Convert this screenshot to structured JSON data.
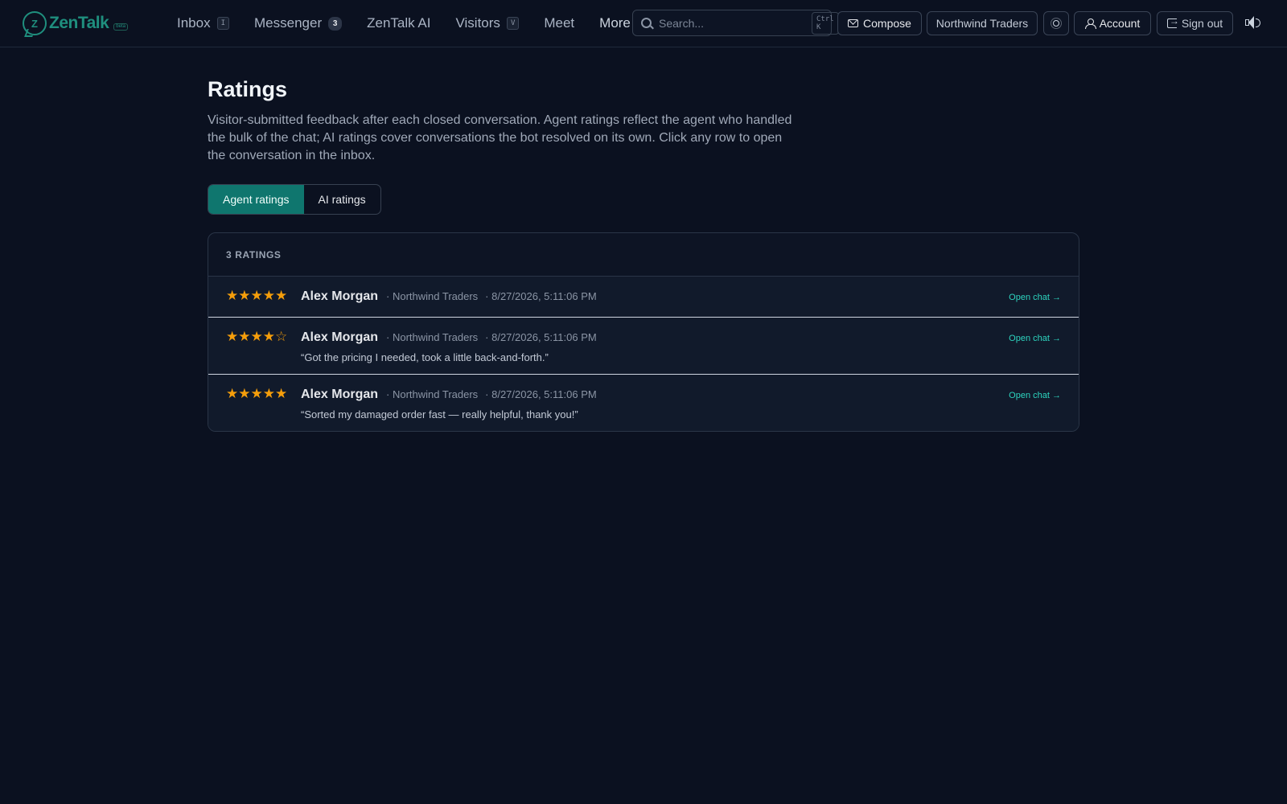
{
  "brand": {
    "name": "ZenTalk",
    "tag": "beta",
    "mark": "Z",
    "accent": "#1f8f7e"
  },
  "nav": {
    "inbox": {
      "label": "Inbox",
      "shortcut": "I"
    },
    "messenger": {
      "label": "Messenger",
      "count": "3"
    },
    "ai": {
      "label": "ZenTalk AI"
    },
    "visitors": {
      "label": "Visitors",
      "shortcut": "V"
    },
    "meet": {
      "label": "Meet"
    },
    "more": {
      "label": "More"
    }
  },
  "search": {
    "placeholder": "Search...",
    "shortcut": "Ctrl K"
  },
  "header_actions": {
    "compose": "Compose",
    "workspace": "Northwind Traders",
    "account": "Account",
    "sign_out": "Sign out",
    "icons": [
      "sun-icon",
      "speaker-icon"
    ]
  },
  "page": {
    "title": "Ratings",
    "description": "Visitor-submitted feedback after each closed conversation. Agent ratings reflect the agent who handled the bulk of the chat; AI ratings cover conversations the bot resolved on its own. Click any row to open the conversation in the inbox."
  },
  "tabs": [
    {
      "label": "Agent ratings",
      "active": true
    },
    {
      "label": "AI ratings",
      "active": false
    }
  ],
  "ratings": {
    "count_label": "3 RATINGS",
    "open_label": "Open chat →",
    "rows": [
      {
        "stars": "★★★★★",
        "rating": 5,
        "agent": "Alex Morgan",
        "company": "· Northwind Traders",
        "date": "· 8/27/2026, 5:11:06 PM",
        "comment": ""
      },
      {
        "stars": "★★★★☆",
        "rating": 4,
        "agent": "Alex Morgan",
        "company": "· Northwind Traders",
        "date": "· 8/27/2026, 5:11:06 PM",
        "comment": "“Got the pricing I needed, took a little back-and-forth.”"
      },
      {
        "stars": "★★★★★",
        "rating": 5,
        "agent": "Alex Morgan",
        "company": "· Northwind Traders",
        "date": "· 8/27/2026, 5:11:06 PM",
        "comment": "“Sorted my damaged order fast — really helpful, thank you!”"
      }
    ]
  },
  "colors": {
    "background": "#0b1120",
    "star": "#f59e0b",
    "link": "#2dd4bf",
    "tab_active": "#0f766e"
  }
}
